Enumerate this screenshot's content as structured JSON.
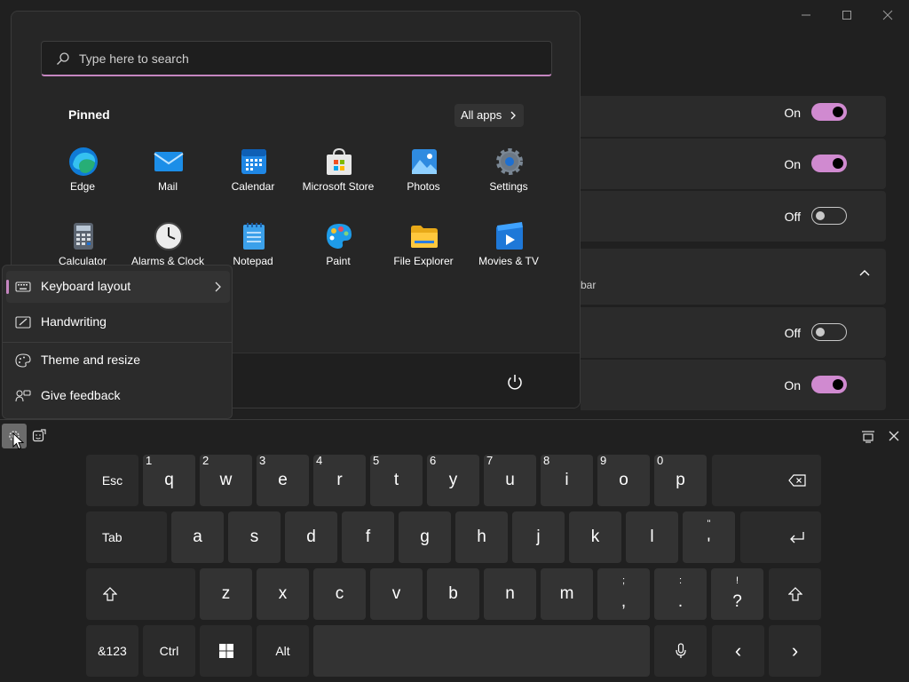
{
  "colors": {
    "accent": "#c586c0",
    "background": "#202020",
    "key": "#333333"
  },
  "settings": {
    "rows": [
      {
        "toggle_label": "On",
        "state": "on"
      },
      {
        "toggle_label": "On",
        "state": "on"
      },
      {
        "toggle_label": "Off",
        "state": "off"
      },
      {
        "text": "bar"
      },
      {
        "toggle_label": "Off",
        "state": "off"
      },
      {
        "toggle_label": "On",
        "state": "on"
      }
    ]
  },
  "start_menu": {
    "search_placeholder": "Type here to search",
    "pinned_title": "Pinned",
    "all_apps_label": "All apps",
    "apps": [
      {
        "label": "Edge",
        "icon": "edge-icon"
      },
      {
        "label": "Mail",
        "icon": "mail-icon"
      },
      {
        "label": "Calendar",
        "icon": "calendar-icon"
      },
      {
        "label": "Microsoft Store",
        "icon": "store-icon"
      },
      {
        "label": "Photos",
        "icon": "photos-icon"
      },
      {
        "label": "Settings",
        "icon": "settings-gear-icon"
      },
      {
        "label": "Calculator",
        "icon": "calculator-icon"
      },
      {
        "label": "Alarms & Clock",
        "icon": "clock-icon"
      },
      {
        "label": "Notepad",
        "icon": "notepad-icon"
      },
      {
        "label": "Paint",
        "icon": "paint-icon"
      },
      {
        "label": "File Explorer",
        "icon": "folder-icon"
      },
      {
        "label": "Movies & TV",
        "icon": "movies-icon"
      }
    ]
  },
  "context_menu": {
    "items": [
      {
        "label": "Keyboard layout",
        "icon": "keyboard-icon"
      },
      {
        "label": "Handwriting",
        "icon": "pen-icon"
      },
      {
        "label": "Theme and resize",
        "icon": "palette-icon"
      },
      {
        "label": "Give feedback",
        "icon": "feedback-icon"
      }
    ]
  },
  "keyboard": {
    "row1_letters": [
      "q",
      "w",
      "e",
      "r",
      "t",
      "y",
      "u",
      "i",
      "o",
      "p"
    ],
    "row1_numbers": [
      "1",
      "2",
      "3",
      "4",
      "5",
      "6",
      "7",
      "8",
      "9",
      "0"
    ],
    "row2_letters": [
      "a",
      "s",
      "d",
      "f",
      "g",
      "h",
      "j",
      "k",
      "l"
    ],
    "row3_letters": [
      "z",
      "x",
      "c",
      "v",
      "b",
      "n",
      "m"
    ],
    "esc": "Esc",
    "tab": "Tab",
    "sym": "&123",
    "ctrl": "Ctrl",
    "alt": "Alt",
    "apostrophe": {
      "top": "\"",
      "main": "'"
    },
    "comma": {
      "top": ";",
      "main": ","
    },
    "period": {
      "top": ":",
      "main": "."
    },
    "question": {
      "top": "!",
      "main": "?"
    },
    "left_arrow": "‹",
    "right_arrow": "›"
  }
}
